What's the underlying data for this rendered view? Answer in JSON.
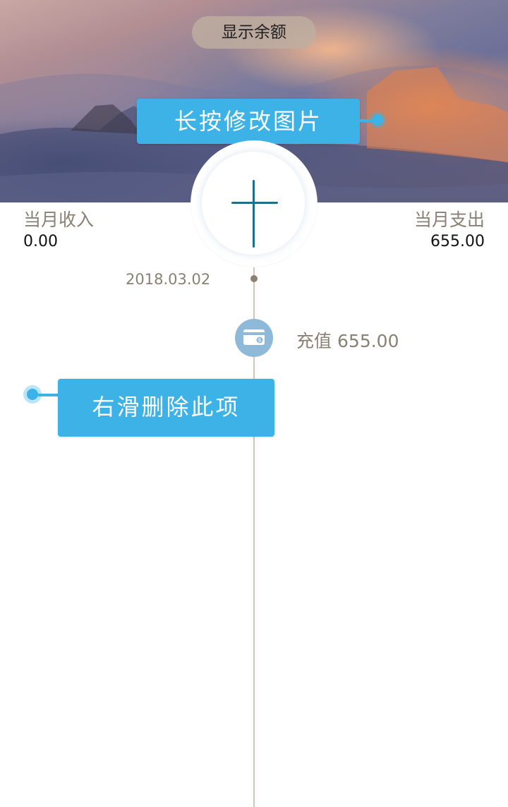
{
  "header": {
    "balance_button_label": "显示余额",
    "change_image_tip": "长按修改图片"
  },
  "summary": {
    "income_label": "当月收入",
    "income_value": "0.00",
    "expense_label": "当月支出",
    "expense_value": "655.00"
  },
  "timeline": {
    "date": "2018.03.02",
    "entries": [
      {
        "category": "充值",
        "amount": "655.00",
        "icon": "card-icon"
      }
    ]
  },
  "tips": {
    "swipe_delete_tip": "右滑删除此项"
  },
  "colors": {
    "tip_blue": "#3cb2e6",
    "plus_stroke": "#1e6f8e",
    "muted_text": "#8a8074",
    "timeline_line": "#d8c3b8",
    "entry_icon_bg": "#8fb9d9"
  }
}
